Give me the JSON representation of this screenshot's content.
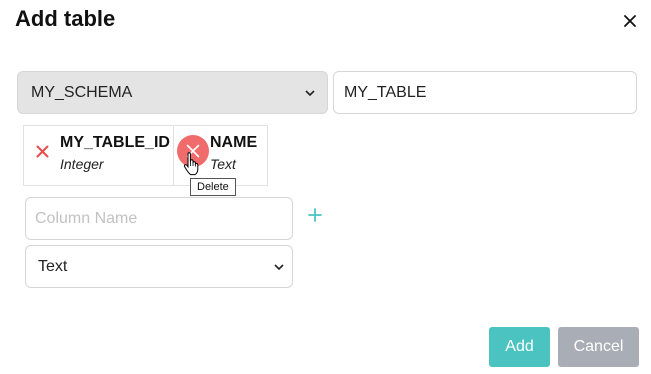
{
  "dialog": {
    "title": "Add table",
    "close_icon": "close-icon"
  },
  "schema_select": {
    "value": "MY_SCHEMA",
    "icon": "chevron-down-icon"
  },
  "table_name": {
    "value": "MY_TABLE"
  },
  "columns": [
    {
      "name": "MY_TABLE_ID",
      "type": "Integer",
      "delete_icon": "delete-x-icon"
    },
    {
      "name": "NAME",
      "type": "Text",
      "delete_icon": "delete-x-icon",
      "hovered": true
    }
  ],
  "tooltip": {
    "text": "Delete"
  },
  "new_column": {
    "name_placeholder": "Column Name",
    "name_value": "",
    "add_icon": "plus-icon",
    "type_value": "Text"
  },
  "buttons": {
    "add_label": "Add",
    "cancel_label": "Cancel"
  },
  "colors": {
    "accent": "#4bc4c1",
    "danger": "#e84c4c",
    "danger_hover": "#f06b6b",
    "secondary": "#a9aeb6"
  }
}
